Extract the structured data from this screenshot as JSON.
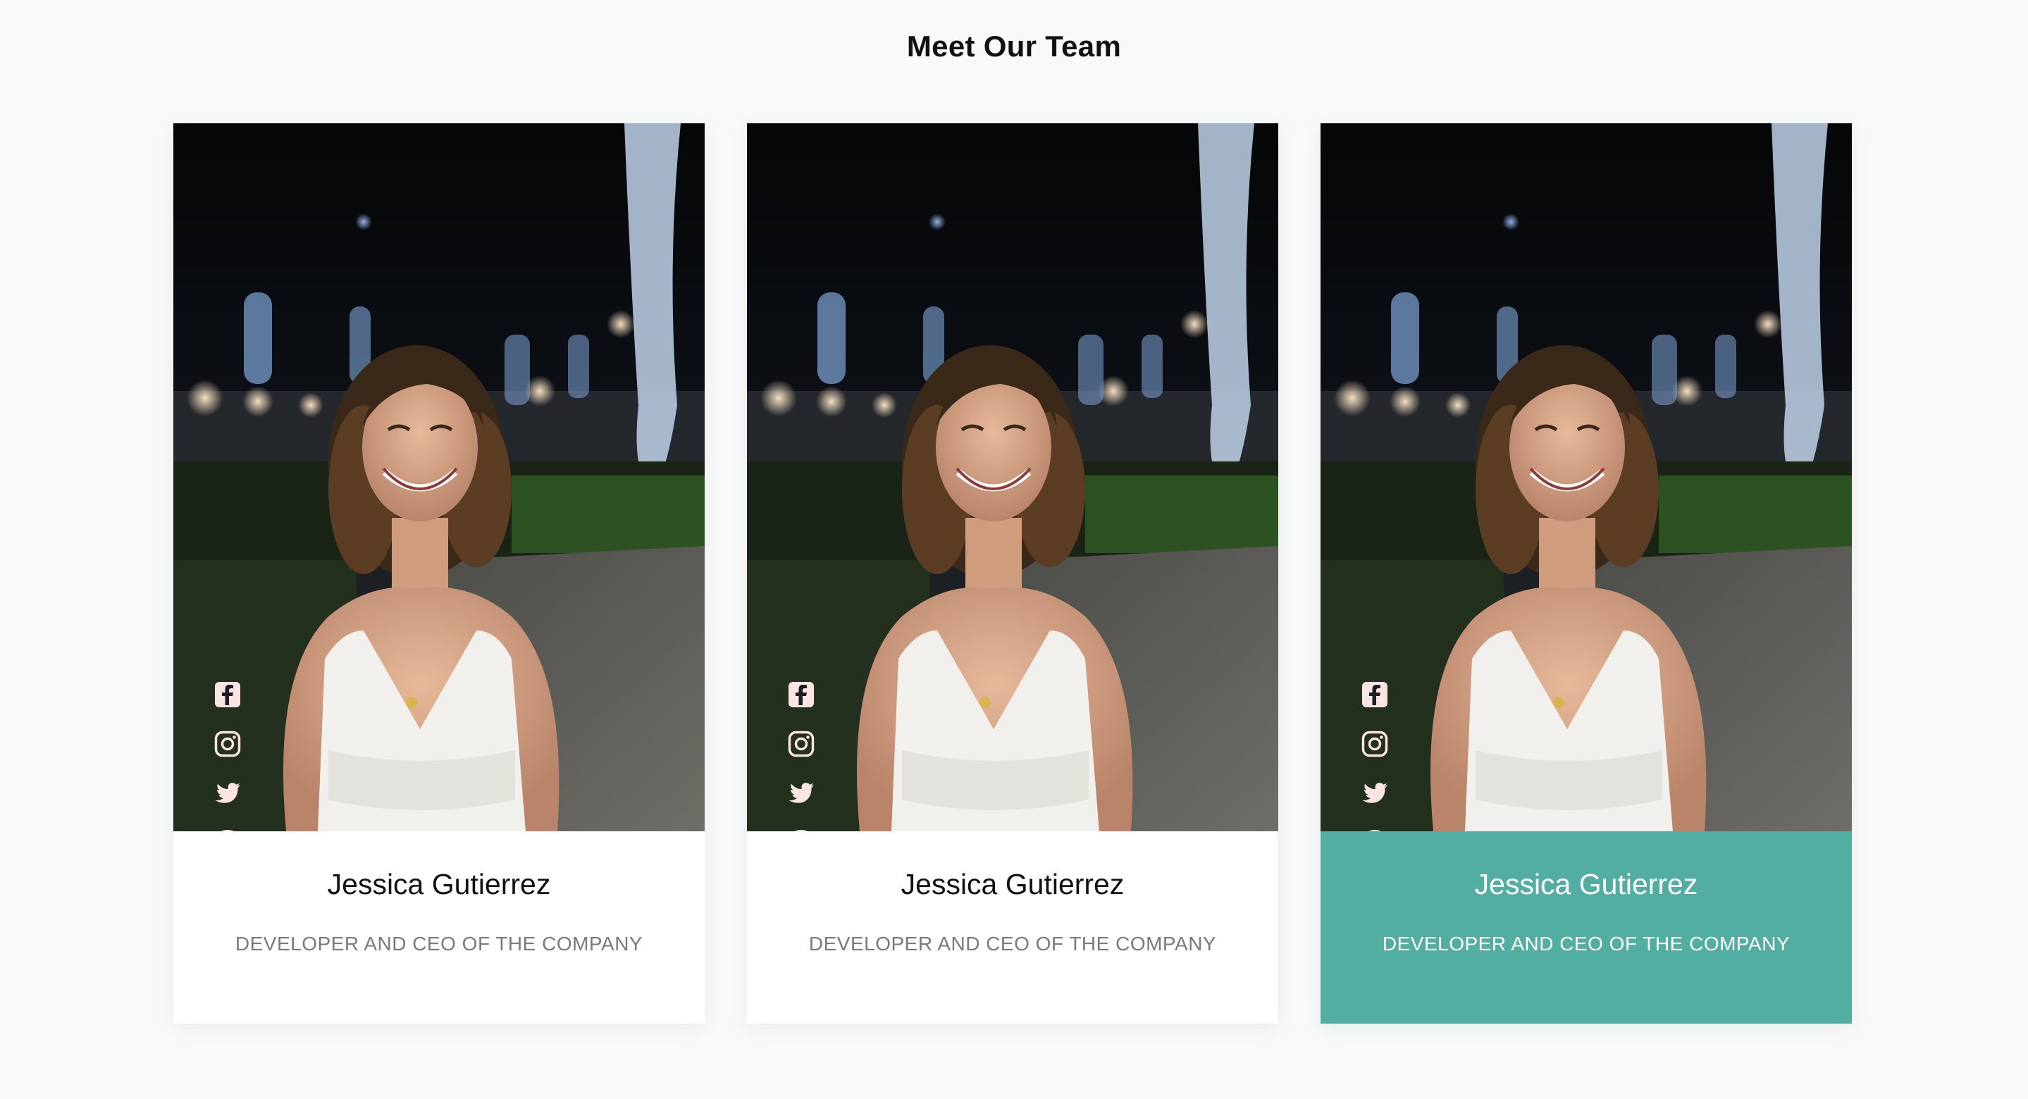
{
  "section": {
    "title": "Meet Our Team"
  },
  "colors": {
    "background": "#f8f9f9",
    "card_background": "#ffffff",
    "active_info_background": "#52ada2",
    "name_text": "#111111",
    "role_text": "#7a7a7a",
    "active_text": "#ffffff",
    "social_icon": "#fde4e4"
  },
  "team": [
    {
      "name": "Jessica Gutierrez",
      "role": "DEVELOPER AND CEO OF THE COMPANY",
      "active": false,
      "photo": "portrait-photo",
      "socials": [
        "facebook-icon",
        "instagram-icon",
        "twitter-icon",
        "github-icon"
      ]
    },
    {
      "name": "Jessica Gutierrez",
      "role": "DEVELOPER AND CEO OF THE COMPANY",
      "active": false,
      "photo": "portrait-photo",
      "socials": [
        "facebook-icon",
        "instagram-icon",
        "twitter-icon",
        "github-icon"
      ]
    },
    {
      "name": "Jessica Gutierrez",
      "role": "DEVELOPER AND CEO OF THE COMPANY",
      "active": true,
      "photo": "portrait-photo",
      "socials": [
        "facebook-icon",
        "instagram-icon",
        "twitter-icon",
        "github-icon"
      ]
    }
  ]
}
